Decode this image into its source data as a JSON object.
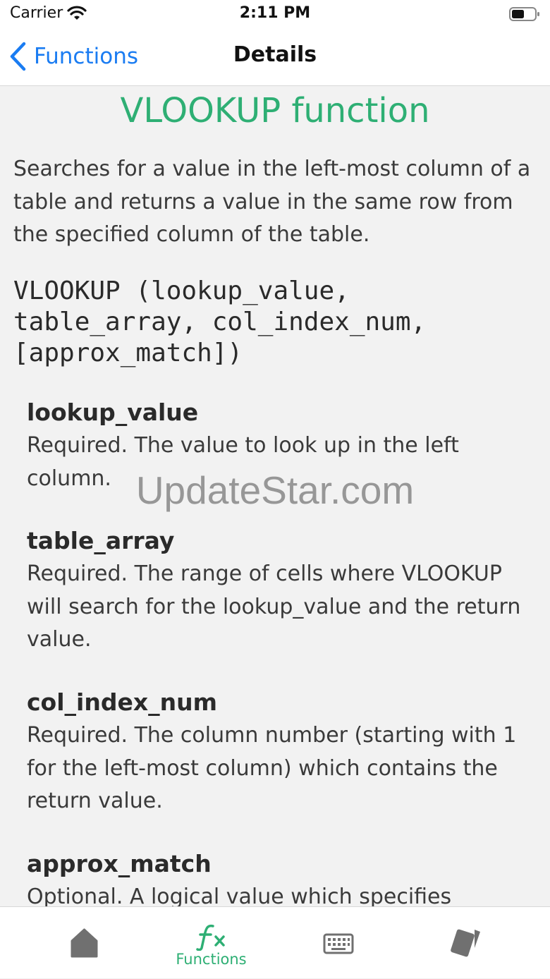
{
  "status_bar": {
    "carrier": "Carrier",
    "time": "2:11 PM"
  },
  "nav": {
    "back_label": "Functions",
    "title": "Details"
  },
  "function": {
    "title": "VLOOKUP function",
    "description": "Searches for a value in the left-most column of a table and returns a value in the same row from the specified column of the table.",
    "syntax": "VLOOKUP (lookup_value,\ntable_array, col_index_num,\n[approx_match])",
    "params": [
      {
        "name": "lookup_value",
        "desc": "Required. The value to look up in the left column."
      },
      {
        "name": "table_array",
        "desc": "Required. The range of cells where VLOOKUP will search for the lookup_value and the return value."
      },
      {
        "name": "col_index_num",
        "desc": "Required. The column number (starting with 1 for the left-most column) which contains the return value."
      },
      {
        "name": "approx_match",
        "desc": "Optional. A logical value which specifies"
      }
    ]
  },
  "watermark": "UpdateStar.com",
  "tabs": [
    {
      "icon": "home-icon",
      "label": ""
    },
    {
      "icon": "function-icon",
      "label": "Functions",
      "active": true
    },
    {
      "icon": "keyboard-icon",
      "label": ""
    },
    {
      "icon": "cards-icon",
      "label": ""
    }
  ],
  "colors": {
    "accent_green": "#2eaf74",
    "link_blue": "#1a7cf2",
    "icon_gray": "#707070"
  }
}
